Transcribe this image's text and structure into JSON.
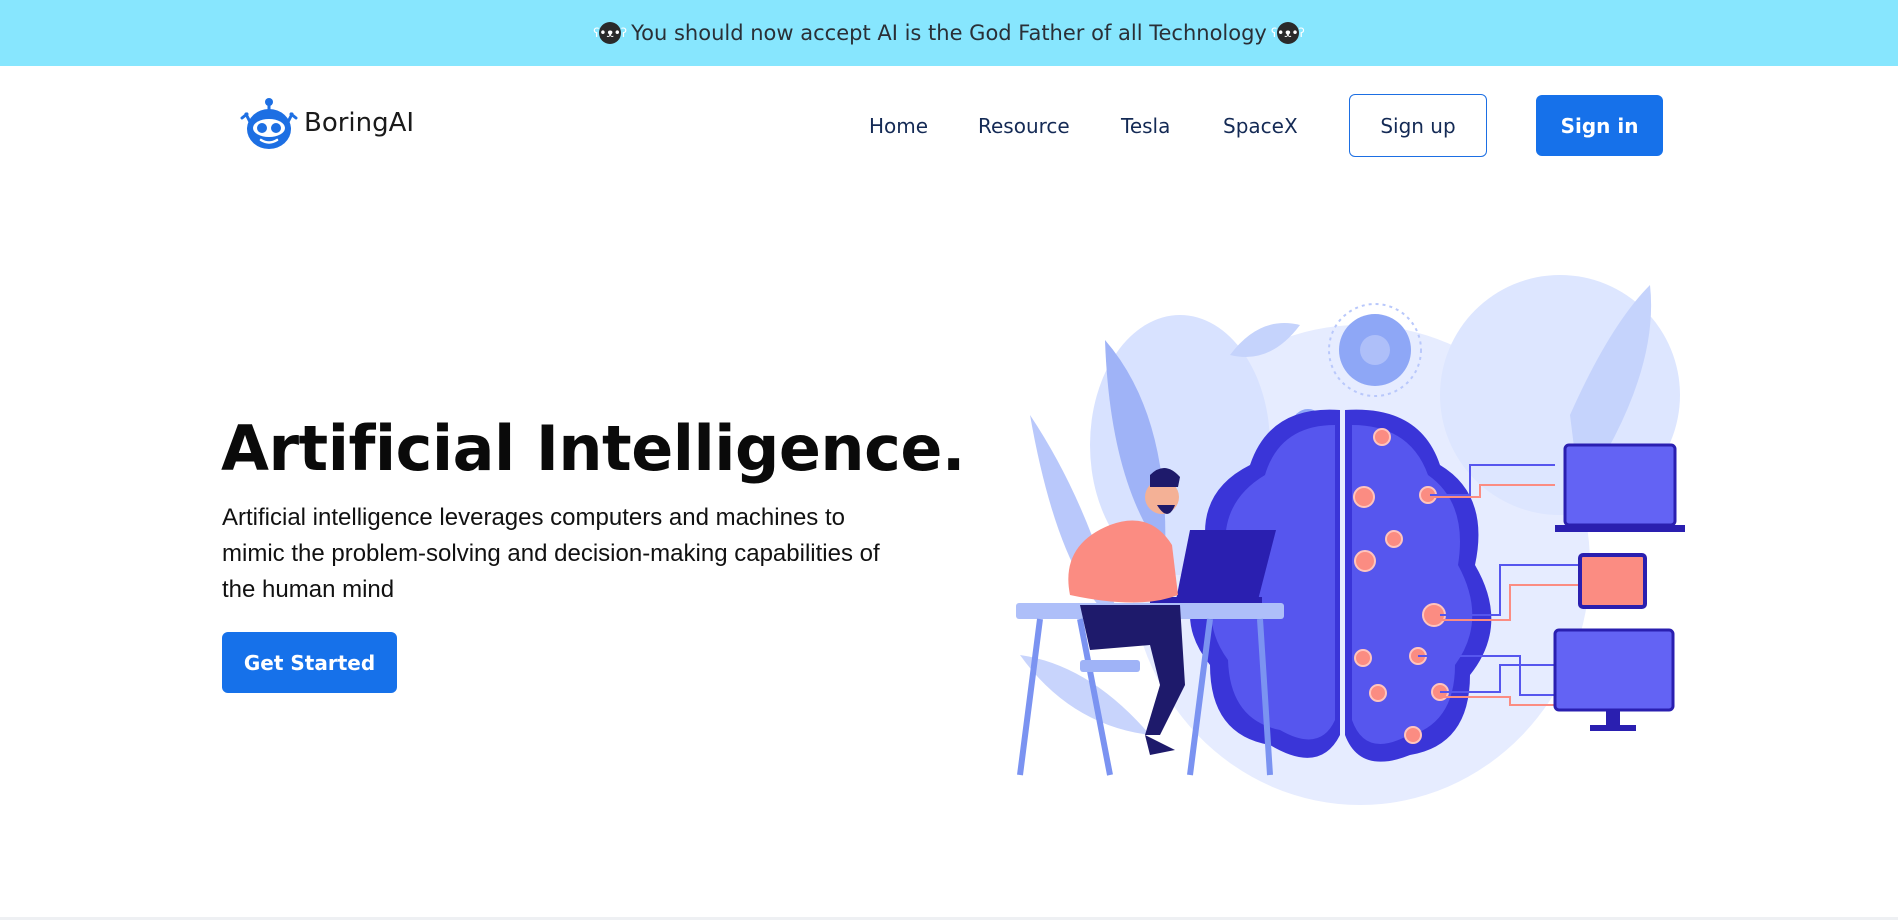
{
  "banner": {
    "text": "You should now accept AI is the God Father of all Technology",
    "emoji_icon": "bear-face-icon"
  },
  "logo": {
    "text": "BoringAI",
    "icon": "robot-head-icon",
    "color": "#1d6fe3"
  },
  "nav": {
    "items": [
      {
        "label": "Home"
      },
      {
        "label": "Resource"
      },
      {
        "label": "Tesla"
      },
      {
        "label": "SpaceX"
      }
    ],
    "signup_label": "Sign up",
    "signin_label": "Sign in"
  },
  "hero": {
    "title": "Artificial Intelligence.",
    "description": "Artificial intelligence leverages computers and machines to mimic the problem-solving and decision-making capabilities of the human mind",
    "cta_label": "Get Started"
  },
  "colors": {
    "banner_bg": "#87e6fe",
    "primary": "#1671ea",
    "nav_text": "#142a55",
    "illustration_blue": "#4f4fe6",
    "illustration_accent": "#fb8c82"
  }
}
